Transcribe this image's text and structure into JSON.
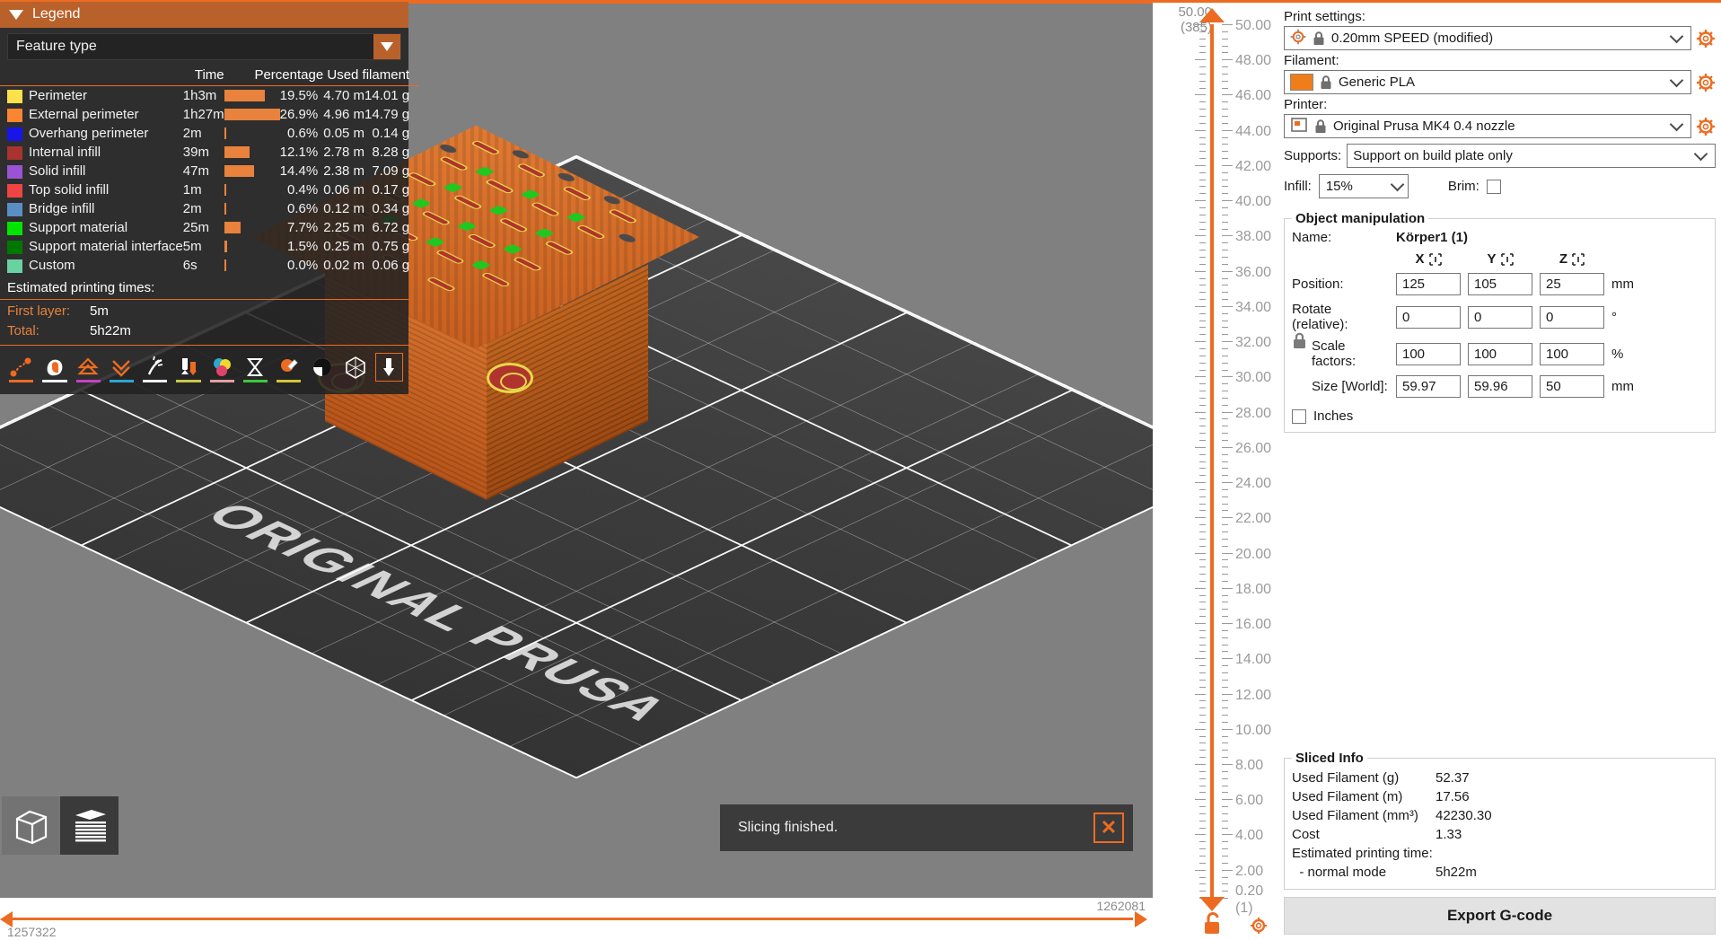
{
  "legend": {
    "title": "Legend",
    "view_type": "Feature type",
    "columns": {
      "time": "Time",
      "percentage": "Percentage",
      "used_filament": "Used filament"
    },
    "rows": [
      {
        "color": "#fbe14a",
        "name": "Perimeter",
        "time": "1h3m",
        "bar_pct": 19.5,
        "percentage": "19.5%",
        "length": "4.70 m",
        "weight": "14.01 g"
      },
      {
        "color": "#fa8632",
        "name": "External perimeter",
        "time": "1h27m",
        "bar_pct": 26.9,
        "percentage": "26.9%",
        "length": "4.96 m",
        "weight": "14.79 g"
      },
      {
        "color": "#1915e8",
        "name": "Overhang perimeter",
        "time": "2m",
        "bar_pct": 0.6,
        "percentage": "0.6%",
        "length": "0.05 m",
        "weight": "0.14 g"
      },
      {
        "color": "#a93330",
        "name": "Internal infill",
        "time": "39m",
        "bar_pct": 12.1,
        "percentage": "12.1%",
        "length": "2.78 m",
        "weight": "8.28 g"
      },
      {
        "color": "#9a53d6",
        "name": "Solid infill",
        "time": "47m",
        "bar_pct": 14.4,
        "percentage": "14.4%",
        "length": "2.38 m",
        "weight": "7.09 g"
      },
      {
        "color": "#ef4444",
        "name": "Top solid infill",
        "time": "1m",
        "bar_pct": 0.4,
        "percentage": "0.4%",
        "length": "0.06 m",
        "weight": "0.17 g"
      },
      {
        "color": "#5b8ec4",
        "name": "Bridge infill",
        "time": "2m",
        "bar_pct": 0.6,
        "percentage": "0.6%",
        "length": "0.12 m",
        "weight": "0.34 g"
      },
      {
        "color": "#00e500",
        "name": "Support material",
        "time": "25m",
        "bar_pct": 7.7,
        "percentage": "7.7%",
        "length": "2.25 m",
        "weight": "6.72 g"
      },
      {
        "color": "#007800",
        "name": "Support material interface",
        "time": "5m",
        "bar_pct": 1.5,
        "percentage": "1.5%",
        "length": "0.25 m",
        "weight": "0.75 g"
      },
      {
        "color": "#6ad2a0",
        "name": "Custom",
        "time": "6s",
        "bar_pct": 0.0,
        "percentage": "0.0%",
        "length": "0.02 m",
        "weight": "0.06 g"
      }
    ],
    "estimated_title": "Estimated printing times:",
    "first_layer_label": "First layer:",
    "first_layer_value": "5m",
    "total_label": "Total:",
    "total_value": "5h22m",
    "toolbar": [
      {
        "name": "travel-icon",
        "underline": "#ed6b21",
        "selected": false
      },
      {
        "name": "retractions-icon",
        "underline": "#ffffff",
        "selected": false
      },
      {
        "name": "seams-icon",
        "underline": "#c840c8",
        "selected": false
      },
      {
        "name": "deretractions-icon",
        "underline": "#2da6d0",
        "selected": false
      },
      {
        "name": "toolchanges-icon",
        "underline": "#f0f0f0",
        "selected": false
      },
      {
        "name": "color-changes-icon",
        "underline": "#c8c84a",
        "selected": false
      },
      {
        "name": "print-pauses-icon",
        "underline": "#e2a0a0",
        "selected": false
      },
      {
        "name": "custom-gcodes-icon",
        "underline": "#3cc83c",
        "selected": false
      },
      {
        "name": "shells-icon",
        "underline": "#d2c832",
        "selected": false
      },
      {
        "name": "tool-marker-icon",
        "underline": "",
        "selected": false
      },
      {
        "name": "bounding-box-icon",
        "underline": "",
        "selected": false
      },
      {
        "name": "legend-toggle-icon",
        "underline": "",
        "selected": true
      }
    ]
  },
  "viewport": {
    "bed_logo": "ORIGINAL PRUSA",
    "view_switch": [
      {
        "name": "3d-editor-view-icon",
        "active": false
      },
      {
        "name": "preview-view-icon",
        "active": true
      }
    ]
  },
  "notification": {
    "message": "Slicing finished.",
    "close_icon": "close-icon"
  },
  "moves_slider": {
    "min": "1257322",
    "max": "1262081"
  },
  "layer_slider": {
    "top_value": "50.00",
    "top_layer": "(385)",
    "bottom_value": "0.20",
    "bottom_layer": "(1)",
    "ticks": [
      "50.00",
      "48.00",
      "46.00",
      "44.00",
      "42.00",
      "40.00",
      "38.00",
      "36.00",
      "34.00",
      "32.00",
      "30.00",
      "28.00",
      "26.00",
      "24.00",
      "22.00",
      "20.00",
      "18.00",
      "16.00",
      "14.00",
      "12.00",
      "10.00",
      "8.00",
      "6.00",
      "4.00",
      "2.00"
    ],
    "lock_icon": "unlocked-icon",
    "gear_icon": "gear-icon"
  },
  "sidebar": {
    "print_settings": {
      "label": "Print settings:",
      "value": "0.20mm SPEED (modified)",
      "preset_icon": "cog-preset-icon",
      "lock_icon": "lock-icon",
      "edit_icon": "gear-icon"
    },
    "filament": {
      "label": "Filament:",
      "value": "Generic PLA",
      "color": "#ee7d1a",
      "lock_icon": "lock-icon",
      "edit_icon": "gear-icon"
    },
    "printer": {
      "label": "Printer:",
      "value": "Original Prusa MK4 0.4 nozzle",
      "preset_icon": "printer-icon",
      "lock_icon": "lock-icon",
      "edit_icon": "gear-icon"
    },
    "supports": {
      "label": "Supports:",
      "value": "Support on build plate only"
    },
    "infill": {
      "label": "Infill:",
      "value": "15%"
    },
    "brim": {
      "label": "Brim:",
      "checked": false
    },
    "object_manipulation": {
      "title": "Object manipulation",
      "name_label": "Name:",
      "name_value": "Körper1 (1)",
      "axes": [
        "X",
        "Y",
        "Z"
      ],
      "rows": [
        {
          "label": "Position:",
          "values": [
            "125",
            "105",
            "25"
          ],
          "unit": "mm"
        },
        {
          "label": "Rotate (relative):",
          "values": [
            "0",
            "0",
            "0"
          ],
          "unit": "°"
        },
        {
          "label": "Scale factors:",
          "values": [
            "100",
            "100",
            "100"
          ],
          "unit": "%"
        },
        {
          "label": "Size [World]:",
          "values": [
            "59.97",
            "59.96",
            "50"
          ],
          "unit": "mm"
        }
      ],
      "inches_label": "Inches",
      "inches_checked": false,
      "lock_icon": "locked-uniform-scale-icon"
    },
    "sliced_info": {
      "title": "Sliced Info",
      "rows": [
        {
          "key": "Used Filament (g)",
          "value": "52.37"
        },
        {
          "key": "Used Filament (m)",
          "value": "17.56"
        },
        {
          "key": "Used Filament (mm³)",
          "value": "42230.30"
        },
        {
          "key": "Cost",
          "value": "1.33"
        },
        {
          "key": "Estimated printing time:",
          "value": ""
        },
        {
          "key": "  - normal mode",
          "value": "5h22m"
        }
      ]
    },
    "export_button": "Export G-code"
  },
  "colors": {
    "accent": "#ed6b21",
    "legend_bg": "#222222",
    "bed": "#3d3d3d"
  }
}
